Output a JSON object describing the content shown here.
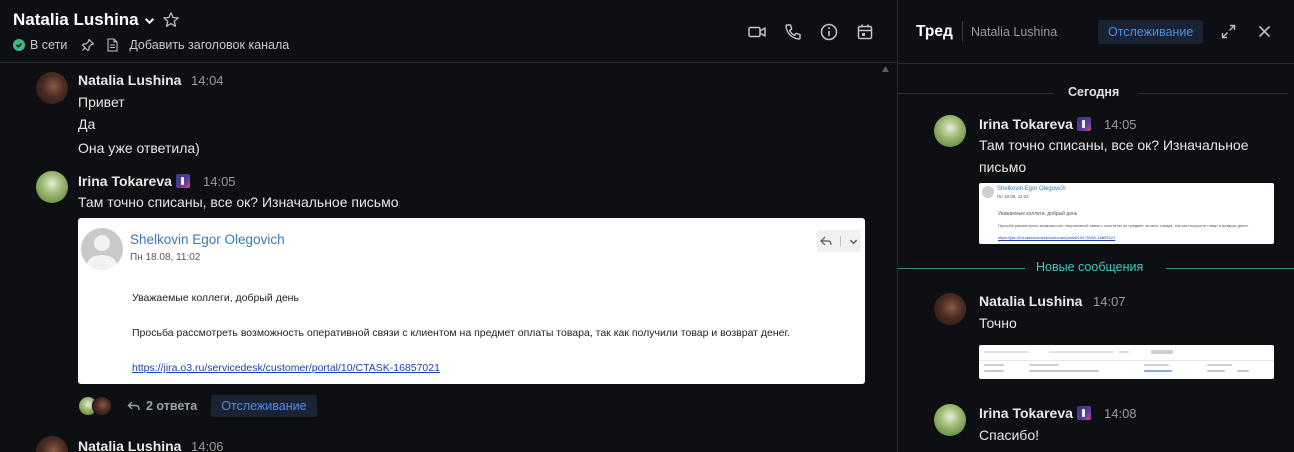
{
  "channel": {
    "title": "Natalia Lushina",
    "status": "В сети",
    "add_header": "Добавить заголовок канала"
  },
  "posts": [
    {
      "author": "Natalia Lushina",
      "time": "14:04",
      "lines": [
        "Привет",
        "Да",
        "Она уже ответила)"
      ]
    },
    {
      "author": "Irina Tokareva",
      "time": "14:05",
      "text": "Там точно списаны, все ок? Изначальное письмо",
      "email": {
        "sender": "Shelkovin Egor Olegovich",
        "date": "Пн 18.08, 11:02",
        "greeting": "Уважаемые коллеги, добрый день",
        "body": "Просьба рассмотреть возможность оперативной связи с клиентом на предмет оплаты товара, так как получили товар и возврат денег.",
        "link": "https://jira.o3.ru/servicedesk/customer/portal/10/CTASK-16857021"
      },
      "replies": "2 ответа",
      "follow": "Отслеживание"
    },
    {
      "author": "Natalia Lushina",
      "time": "14:06"
    }
  ],
  "thread": {
    "title": "Тред",
    "channel": "Natalia Lushina",
    "follow": "Отслеживание",
    "today": "Сегодня",
    "new_messages": "Новые сообщения",
    "messages": [
      {
        "author": "Irina Tokareva",
        "time": "14:05",
        "text_1": "Там точно списаны, все ок? Изначальное",
        "text_2": "письмо"
      },
      {
        "author": "Natalia Lushina",
        "time": "14:07",
        "text": "Точно"
      },
      {
        "author": "Irina Tokareva",
        "time": "14:08",
        "text": "Спасибо!"
      }
    ]
  },
  "colors": {
    "background": "#0e0f12",
    "accent": "#4e8fe0",
    "online": "#3db887",
    "new_messages": "#3ec9c3"
  }
}
